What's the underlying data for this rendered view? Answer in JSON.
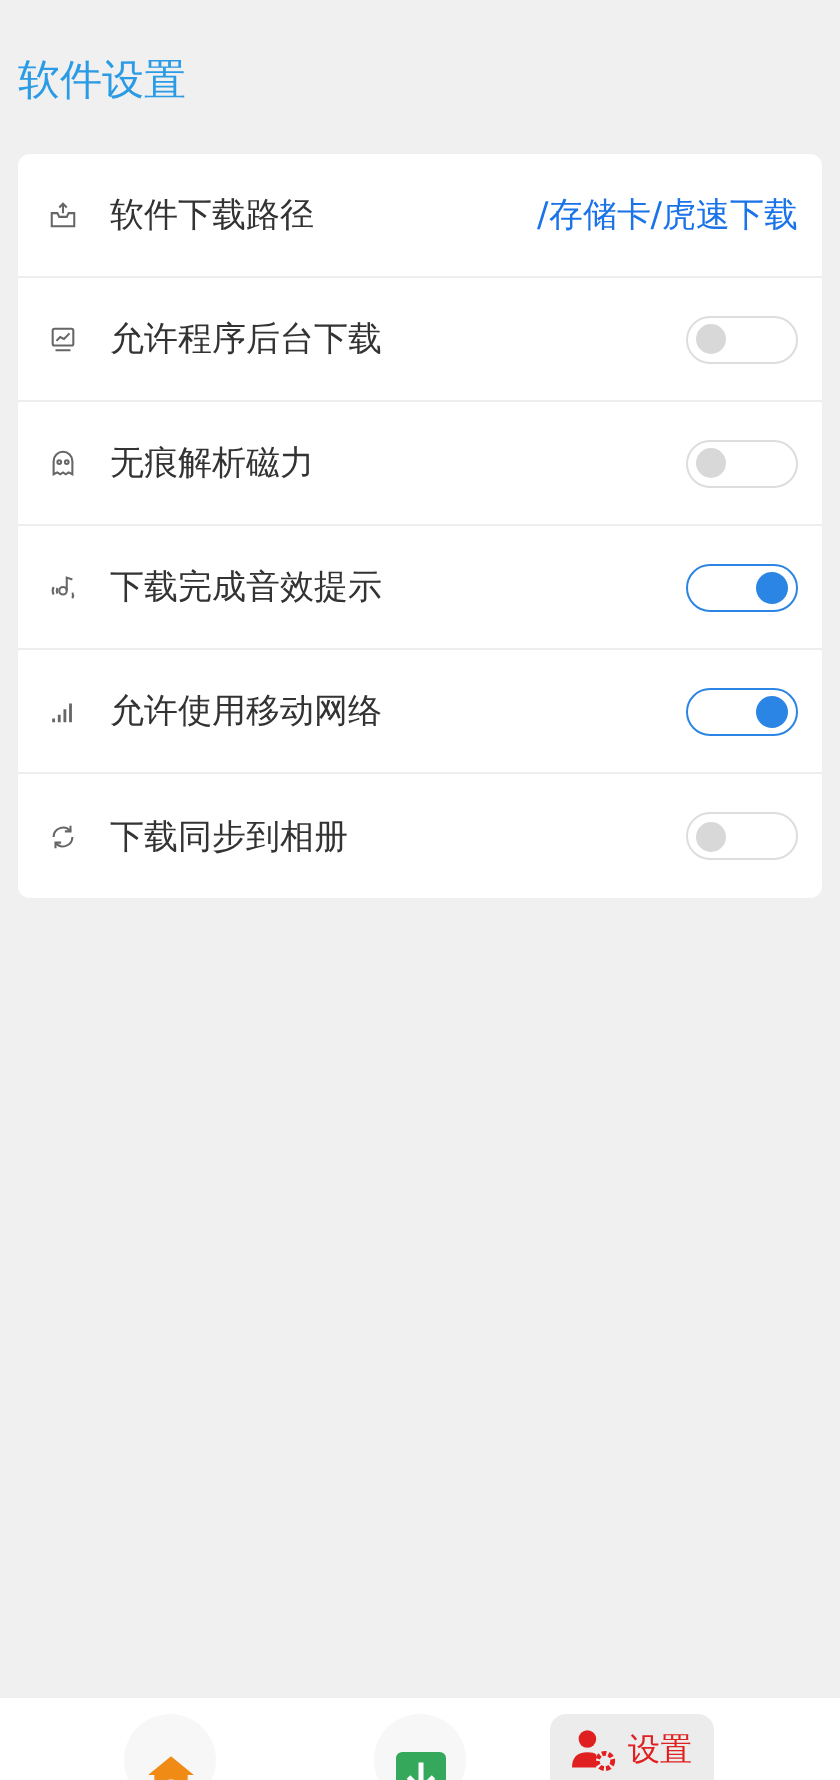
{
  "title": "软件设置",
  "settings": [
    {
      "kind": "path",
      "label": "软件下载路径",
      "value": "/存储卡/虎速下载"
    },
    {
      "kind": "toggle",
      "label": "允许程序后台下载",
      "on": false
    },
    {
      "kind": "toggle",
      "label": "无痕解析磁力",
      "on": false
    },
    {
      "kind": "toggle",
      "label": "下载完成音效提示",
      "on": true
    },
    {
      "kind": "toggle",
      "label": "允许使用移动网络",
      "on": true
    },
    {
      "kind": "toggle",
      "label": "下载同步到相册",
      "on": false
    }
  ],
  "nav": [
    {
      "selected": false
    },
    {
      "selected": false
    },
    {
      "selected": true,
      "label": "设置"
    }
  ]
}
